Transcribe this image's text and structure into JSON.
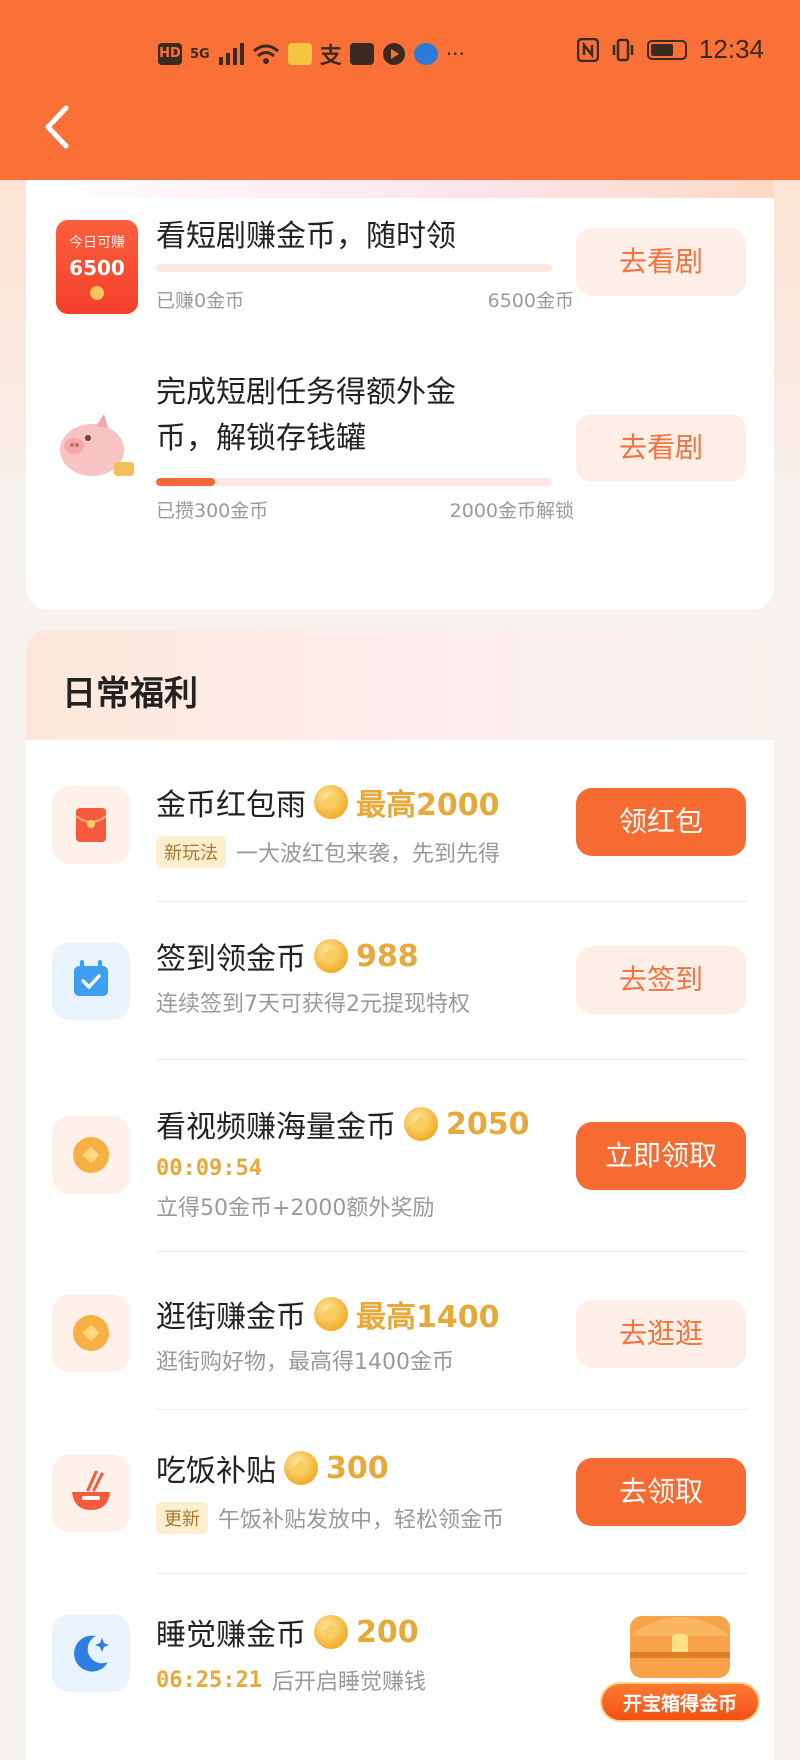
{
  "status_bar": {
    "hd": "HD",
    "network": "5G",
    "time": "12:34"
  },
  "drama_section": {
    "item1": {
      "badge_line1": "今日可赚",
      "badge_amount": "6500",
      "title": "看短剧赚金币，随时领",
      "progress_left": "已赚0金币",
      "progress_right": "6500金币",
      "progress_fraction": 0,
      "button": "去看剧"
    },
    "item2": {
      "title_line1": "完成短剧任务得额外金",
      "title_line2": "币，解锁存钱罐",
      "progress_left": "已攒300金币",
      "progress_right": "2000金币解锁",
      "progress_fraction": 0.15,
      "button": "去看剧"
    }
  },
  "daily": {
    "title": "日常福利",
    "tasks": [
      {
        "title": "金币红包雨",
        "reward": "最高2000",
        "tag": "新玩法",
        "sub": "一大波红包来袭，先到先得",
        "button": "领红包",
        "button_style": "solid",
        "icon": "red-envelope-icon"
      },
      {
        "title": "签到领金币",
        "reward": "988",
        "sub": "连续签到7天可获得2元提现特权",
        "button": "去签到",
        "button_style": "soft",
        "icon": "calendar-check-icon"
      },
      {
        "title": "看视频赚海量金币",
        "reward": "2050",
        "timer": "00:09:54",
        "sub": "立得50金币+2000额外奖励",
        "button": "立即领取",
        "button_style": "solid",
        "icon": "coin-icon"
      },
      {
        "title": "逛街赚金币",
        "reward": "最高1400",
        "sub": "逛街购好物，最高得1400金币",
        "button": "去逛逛",
        "button_style": "soft",
        "icon": "coin-icon"
      },
      {
        "title": "吃饭补贴",
        "reward": "300",
        "tag": "更新",
        "sub": "午饭补贴发放中，轻松领金币",
        "button": "去领取",
        "button_style": "solid",
        "icon": "bowl-icon"
      },
      {
        "title": "睡觉赚金币",
        "reward": "200",
        "timer": "06:25:21",
        "sub": "后开启睡觉赚钱",
        "icon": "moon-icon"
      }
    ]
  },
  "chest": {
    "label": "开宝箱得金币"
  },
  "colors": {
    "header": "#fa7137",
    "accent": "#f56b32",
    "gold": "#e6a93a"
  }
}
